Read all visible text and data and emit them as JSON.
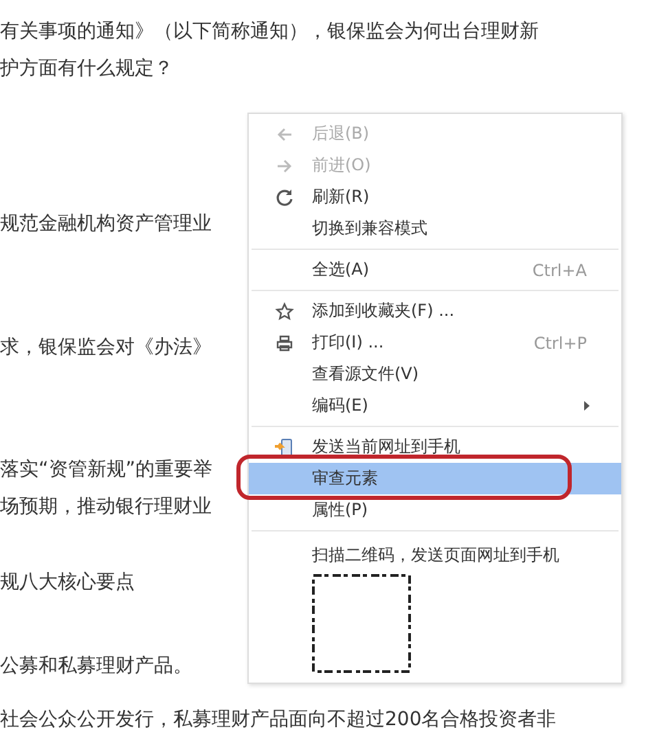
{
  "article": {
    "paragraphs": [
      {
        "lines": [
          "有关事项的通知》（以下简称通知），银保监会为何出台理财新",
          "护方面有什么规定？"
        ]
      },
      {
        "lines": [
          "规范金融机构资产管理业"
        ]
      },
      {
        "lines": [
          "求，银保监会对《办法》"
        ]
      },
      {
        "lines": [
          "落实“资管新规”的重要举",
          "场预期，推动银行理财业"
        ]
      },
      {
        "lines": [
          "规八大核心要点"
        ]
      },
      {
        "lines": [
          "公募和私募理财产品。"
        ]
      },
      {
        "lines": [
          "社会公众公开发行，私募理财产品面向不超过200名合格投资者非"
        ]
      }
    ]
  },
  "context_menu": {
    "items": [
      {
        "kind": "command",
        "label": "后退(B)",
        "disabled": true,
        "selected": false
      },
      {
        "kind": "command",
        "label": "前进(O)",
        "disabled": true,
        "selected": false
      },
      {
        "kind": "command",
        "label": "刷新(R)",
        "disabled": false,
        "selected": false
      },
      {
        "kind": "command",
        "label": "切换到兼容模式",
        "disabled": false,
        "selected": false
      },
      {
        "kind": "separator"
      },
      {
        "kind": "command",
        "label": "全选(A)",
        "shortcut": "Ctrl+A",
        "disabled": false,
        "selected": false
      },
      {
        "kind": "separator"
      },
      {
        "kind": "command",
        "label": "添加到收藏夹(F) ...",
        "disabled": false,
        "selected": false
      },
      {
        "kind": "command",
        "label": "打印(I) ...",
        "shortcut": "Ctrl+P",
        "disabled": false,
        "selected": false
      },
      {
        "kind": "command",
        "label": "查看源文件(V)",
        "disabled": false,
        "selected": false
      },
      {
        "kind": "command",
        "label": "编码(E)",
        "submenu": true,
        "disabled": false,
        "selected": false
      },
      {
        "kind": "separator"
      },
      {
        "kind": "command",
        "label": "发送当前网址到手机",
        "disabled": false,
        "selected": false
      },
      {
        "kind": "command",
        "label": "审查元素",
        "disabled": false,
        "selected": true,
        "circled": true
      },
      {
        "kind": "command",
        "label": "属性(P)",
        "disabled": false,
        "selected": false
      },
      {
        "kind": "separator"
      },
      {
        "kind": "qr",
        "label": "扫描二维码，发送页面网址到手机"
      }
    ]
  }
}
